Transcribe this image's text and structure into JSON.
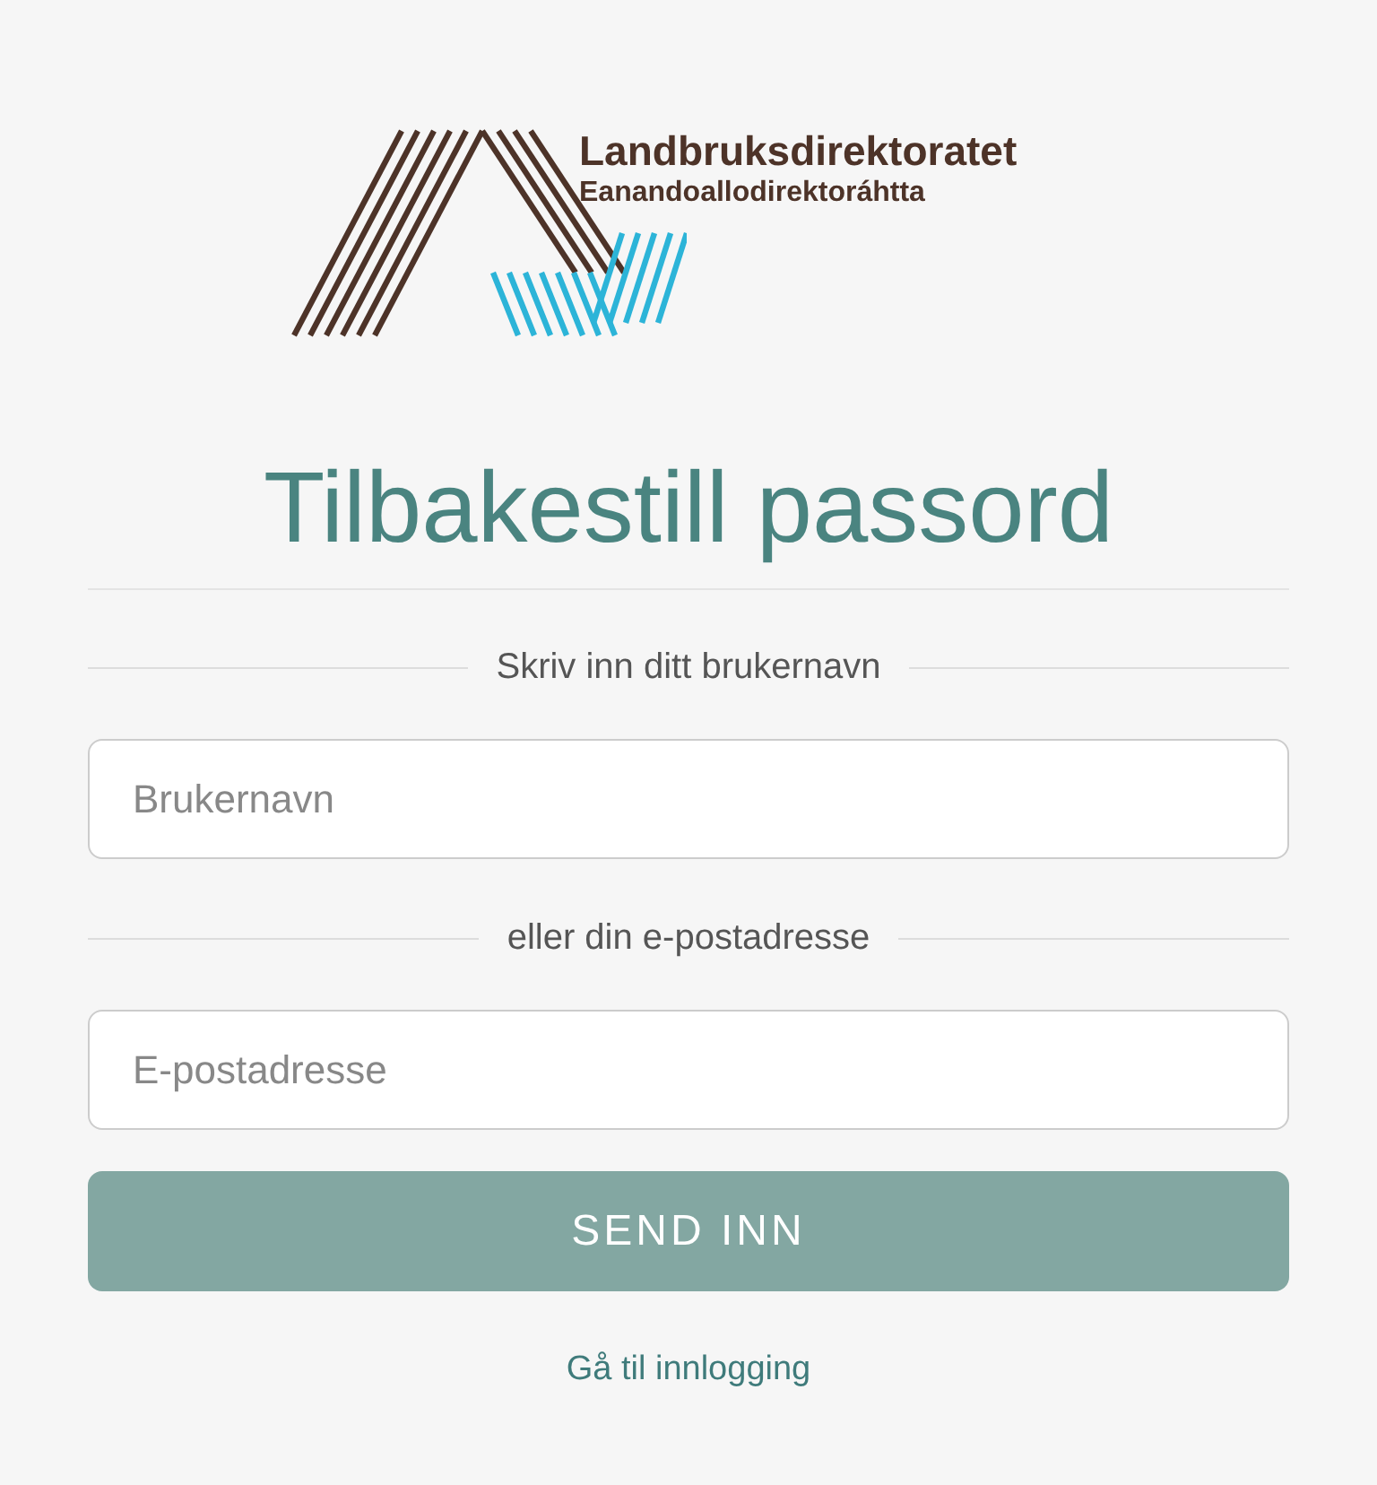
{
  "logo": {
    "name": "Landbruksdirektoratet",
    "subtitle": "Eanandoallodirektoráhtta"
  },
  "title": "Tilbakestill passord",
  "username_divider": "Skriv inn ditt brukernavn",
  "username_field": {
    "placeholder": "Brukernavn"
  },
  "email_divider": "eller din e-postadresse",
  "email_field": {
    "placeholder": "E-postadresse"
  },
  "submit_button": "SEND INN",
  "login_link": "Gå til innlogging"
}
